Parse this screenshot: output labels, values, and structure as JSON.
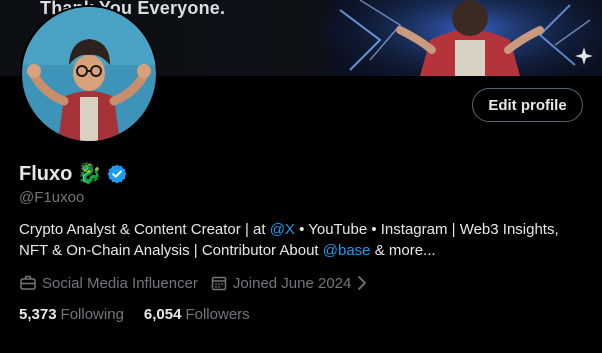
{
  "banner": {
    "text": "Thank You Everyone."
  },
  "profile": {
    "edit_label": "Edit profile",
    "name": "Fluxo",
    "name_emoji": "🐉",
    "handle": "@F1uxoo",
    "bio": {
      "part1": "Crypto Analyst & Content Creator | at ",
      "mention1": "@X",
      "part2": " • YouTube • Instagram | Web3 Insights, NFT & On-Chain Analysis | Contributor About ",
      "mention2": "@base",
      "part3": " & more..."
    },
    "category": "Social Media Influencer",
    "joined": "Joined June 2024"
  },
  "stats": {
    "following_count": "5,373",
    "following_label": "Following",
    "followers_count": "6,054",
    "followers_label": "Followers"
  },
  "colors": {
    "background": "#000000",
    "text": "#e7e9ea",
    "muted": "#71767b",
    "link": "#1d9bf0",
    "verified": "#1d9bf0"
  }
}
